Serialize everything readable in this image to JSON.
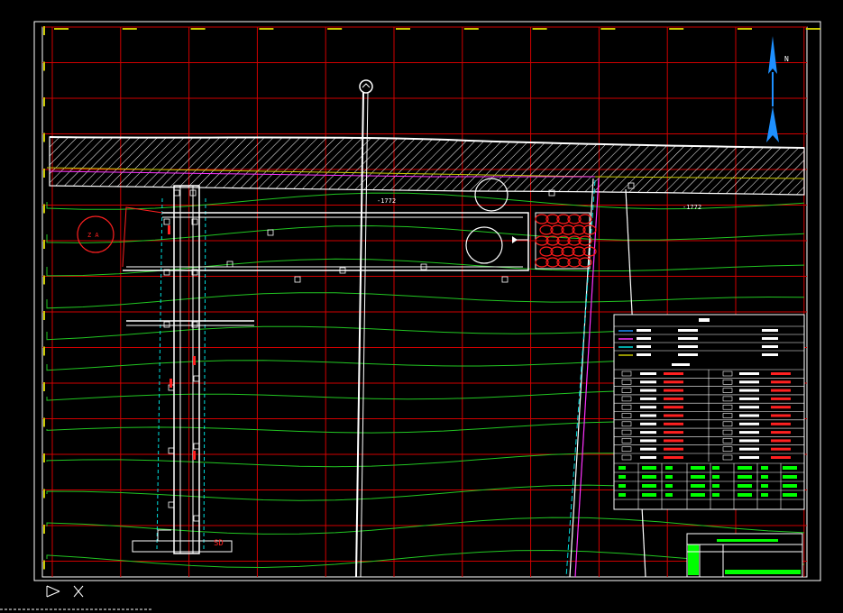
{
  "drawing": {
    "north_label": "N",
    "elevation_tags": [
      "-1772",
      "-1772"
    ],
    "north_arrow_color": "#1e90ff",
    "legend_header_text": "",
    "colors": {
      "grid": "#d10000",
      "contour": "#22c622",
      "border": "#ffffff",
      "shaft": "#00e0e0",
      "magenta": "#ff33ff",
      "hatch": "#ffffff",
      "rock_fill": "#ff1a1a",
      "table_green": "#00ff00",
      "table_red": "#ff2020"
    }
  }
}
